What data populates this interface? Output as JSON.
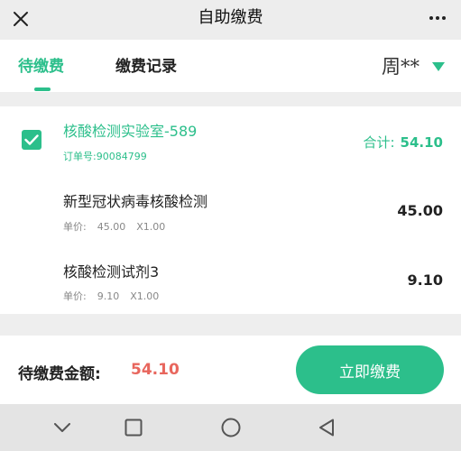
{
  "header": {
    "title": "自助缴费",
    "close_icon": "close-icon",
    "more_icon": "more-horizontal-icon"
  },
  "tabs": [
    {
      "label": "待缴费",
      "active": true
    },
    {
      "label": "缴费记录",
      "active": false
    }
  ],
  "patient": {
    "name": "周**",
    "dropdown_icon": "triangle-down-icon"
  },
  "order": {
    "checked": true,
    "lab_name": "核酸检测实验室-589",
    "order_number_label": "订单号:",
    "order_number": "90084799",
    "total_label": "合计:",
    "total": "54.10",
    "items": [
      {
        "name": "新型冠状病毒核酸检测",
        "unit_price_label": "单价:",
        "unit_price": "45.00",
        "quantity": "X1.00",
        "amount": "45.00"
      },
      {
        "name": "核酸检测试剂3",
        "unit_price_label": "单价:",
        "unit_price": "9.10",
        "quantity": "X1.00",
        "amount": "9.10"
      }
    ]
  },
  "footer": {
    "pending_label": "待缴费金额:",
    "pending_amount": "54.10",
    "pay_button": "立即缴费"
  },
  "system_nav": {
    "back_icon": "chevron-down-icon",
    "home_icon": "square-icon",
    "recents_icon": "circle-icon",
    "triangle_icon": "triangle-left-icon"
  },
  "colors": {
    "accent": "#2cbf8b",
    "amount_red": "#e8665d",
    "background": "#eeeeee"
  }
}
